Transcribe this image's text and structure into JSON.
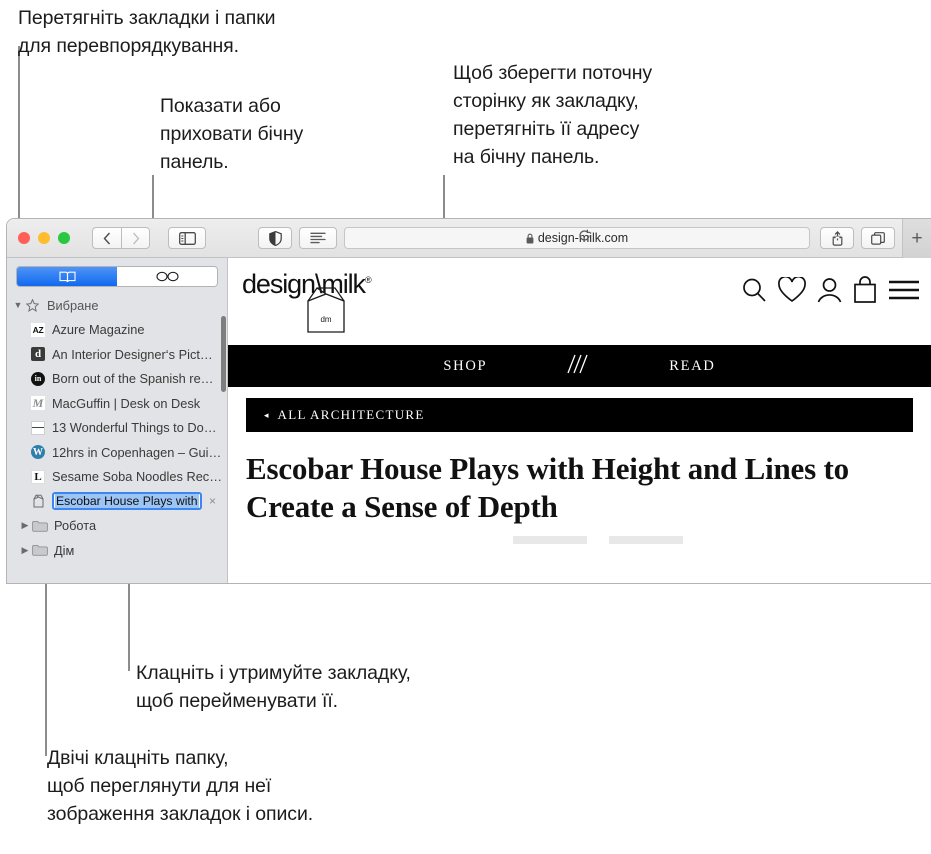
{
  "annotations": [
    {
      "id": "drag-reorder",
      "text": "Перетягніть закладки і папки\nдля перевпорядкування."
    },
    {
      "id": "show-hide-sidebar",
      "text": "Показати або\nприховати бічну\nпанель."
    },
    {
      "id": "save-page-bookmark",
      "text": "Щоб зберегти поточну\nсторінку як закладку,\nперетягніть її адресу\nна бічну панель."
    },
    {
      "id": "click-hold-rename",
      "text": "Клацніть і утримуйте закладку,\nщоб перейменувати її."
    },
    {
      "id": "double-click-folder",
      "text": "Двічі клацніть папку,\nщоб переглянути для неї\nзображення закладок і описи."
    }
  ],
  "window": {
    "toolbar": {
      "traffic_lights": [
        "close",
        "minimize",
        "zoom"
      ],
      "back_label": "‹",
      "forward_label": "›",
      "sidebar_toggle_name": "sidebar-toggle",
      "privacy_name": "privacy-report",
      "reader_name": "reader-view",
      "url": "design-milk.com",
      "lock_glyph": "🔒",
      "reload_glyph": "⟳",
      "share_name": "share",
      "tabs_name": "tab-overview",
      "new_tab_label": "+"
    },
    "sidebar": {
      "tabs": [
        {
          "id": "bookmarks",
          "icon": "book-icon",
          "selected": true
        },
        {
          "id": "reading-list",
          "icon": "glasses-icon",
          "selected": false
        }
      ],
      "groups": [
        {
          "label": "Вибране",
          "icon": "star-icon",
          "expanded": true,
          "items": [
            {
              "label": "Azure Magazine",
              "favicon": "AZ",
              "favicon_class": "fv-az"
            },
            {
              "label": "An Interior Designer‘s Pict…",
              "favicon": "d",
              "favicon_class": "fv-d"
            },
            {
              "label": "Born out of the Spanish re…",
              "favicon": "in",
              "favicon_class": "fv-in"
            },
            {
              "label": "MacGuffin | Desk on Desk",
              "favicon": "M",
              "favicon_class": "fv-m"
            },
            {
              "label": "13 Wonderful Things to Do…",
              "favicon": "",
              "favicon_class": "fv-13"
            },
            {
              "label": "12hrs in Copenhagen – Gui…",
              "favicon": "W",
              "favicon_class": "fv-wp"
            },
            {
              "label": "Sesame Soba Noodles Rec…",
              "favicon": "L",
              "favicon_class": "fv-l"
            }
          ]
        }
      ],
      "editing_item": {
        "value": "Escobar House Plays with ",
        "favicon": "carton-icon",
        "clear_glyph": "×"
      },
      "folders": [
        {
          "label": "Робота",
          "icon": "folder-icon",
          "expanded": false
        },
        {
          "label": "Дім",
          "icon": "folder-icon",
          "expanded": false
        }
      ]
    },
    "page": {
      "logo_text": "design\\milk",
      "logo_mark": "®",
      "carton_label": "dm",
      "header_icons": [
        "search-icon",
        "heart-icon",
        "account-icon",
        "bag-icon",
        "hamburger-icon"
      ],
      "nav": [
        {
          "label": "SHOP"
        },
        {
          "label": "\\\\\\"
        },
        {
          "label": "READ"
        }
      ],
      "breadcrumb": {
        "arrow": "◂",
        "label": "ALL ARCHITECTURE"
      },
      "headline": "Escobar House Plays with Height and Lines to Create a Sense of Depth"
    }
  },
  "colors": {
    "accent_blue": "#1169ef",
    "selection_blue": "#9cc4f5",
    "sidebar_bg": "#e2e3e6",
    "nav_black": "#000000",
    "leader_gray": "#8c8c8c"
  }
}
